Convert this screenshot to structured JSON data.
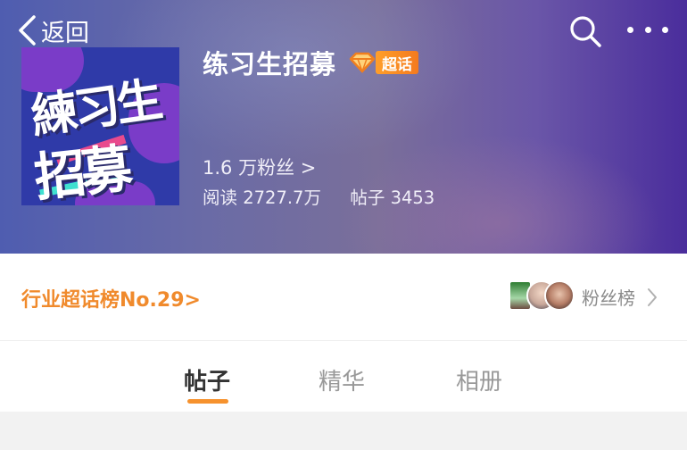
{
  "nav": {
    "back_label": "返回"
  },
  "topic": {
    "title": "练习生招募",
    "badge": "超话",
    "cover_line1": "練习生",
    "cover_line2": "招募",
    "fans": "1.6 万粉丝 >",
    "reads_label": "阅读",
    "reads_value": "2727.7万",
    "posts_label": "帖子",
    "posts_value": "3453"
  },
  "rank": {
    "link": "行业超话榜No.29>",
    "fans_rank_label": "粉丝榜"
  },
  "tabs": [
    {
      "label": "帖子",
      "active": true
    },
    {
      "label": "精华",
      "active": false
    },
    {
      "label": "相册",
      "active": false
    }
  ],
  "colors": {
    "accent_orange": "#f08a2c",
    "badge_orange": "#f47a1e",
    "header_purple": "#4a2d9c",
    "header_blue": "#4f5db0"
  },
  "icons": [
    "chevron-left-icon",
    "search-icon",
    "more-icon",
    "diamond-icon",
    "chevron-right-icon"
  ]
}
